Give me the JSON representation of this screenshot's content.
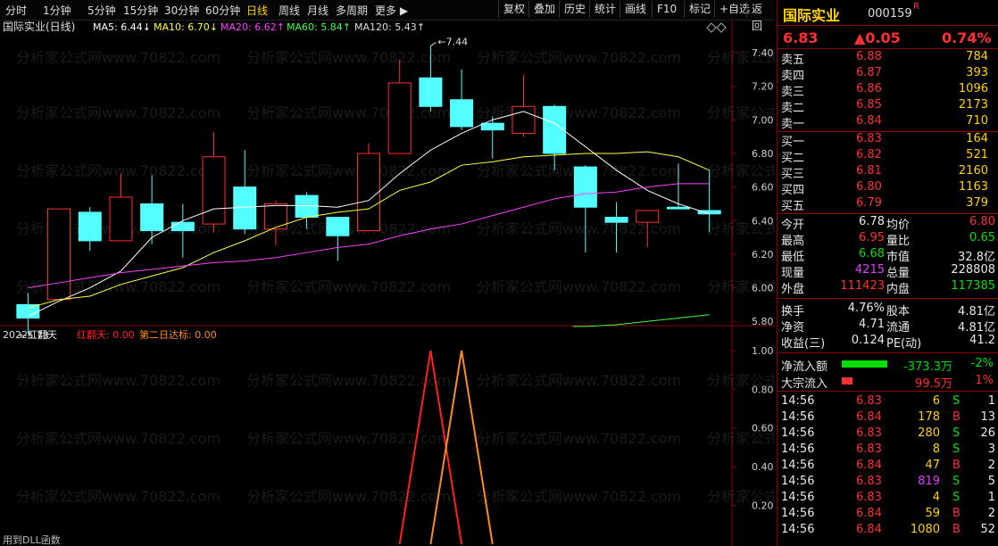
{
  "toolbar": {
    "periods": [
      "分时",
      "1分钟",
      "5分钟",
      "15分钟",
      "30分钟",
      "60分钟",
      "日线",
      "周线",
      "月线",
      "多周期",
      "更多"
    ],
    "active_period": "日线",
    "buttons": [
      "复权",
      "叠加",
      "历史",
      "统计",
      "画线",
      "F10",
      "标记",
      "+自选",
      "返回"
    ]
  },
  "chart_title": "国际实业(日线)",
  "ma_legend": [
    {
      "label": "MA5: 6.44↓",
      "color": "#ffffff"
    },
    {
      "label": "MA10: 6.70↓",
      "color": "#ffff40"
    },
    {
      "label": "MA20: 6.62↑",
      "color": "#ff40ff"
    },
    {
      "label": "MA60: 5.84↑",
      "color": "#40ff40"
    },
    {
      "label": "MA120: 5.43↑",
      "color": "#dddddd"
    }
  ],
  "annotations": {
    "high": "7.44",
    "low": "5.73"
  },
  "indicator": {
    "name": "2022红翻天",
    "s1": "红翻天: 0.00",
    "s2": "第二日达标: 0.00",
    "footer": "用到DLL函数"
  },
  "watermark": "分析家公式网www.70822.com",
  "chart_data": [
    {
      "type": "candlestick",
      "title": "国际实业(日线)",
      "ylim": [
        5.78,
        7.48
      ],
      "yticks": [
        5.8,
        6.0,
        6.2,
        6.4,
        6.6,
        6.8,
        7.0,
        7.2,
        7.4
      ],
      "candles": [
        {
          "o": 5.9,
          "c": 5.82,
          "h": 5.97,
          "l": 5.73
        },
        {
          "o": 5.93,
          "c": 6.47,
          "h": 6.47,
          "l": 5.93
        },
        {
          "o": 6.45,
          "c": 6.28,
          "h": 6.48,
          "l": 6.22
        },
        {
          "o": 6.28,
          "c": 6.54,
          "h": 6.68,
          "l": 6.28
        },
        {
          "o": 6.5,
          "c": 6.34,
          "h": 6.67,
          "l": 6.26
        },
        {
          "o": 6.39,
          "c": 6.34,
          "h": 6.5,
          "l": 6.18
        },
        {
          "o": 6.38,
          "c": 6.78,
          "h": 6.93,
          "l": 6.33
        },
        {
          "o": 6.6,
          "c": 6.35,
          "h": 6.82,
          "l": 6.32
        },
        {
          "o": 6.35,
          "c": 6.5,
          "h": 6.52,
          "l": 6.25
        },
        {
          "o": 6.55,
          "c": 6.42,
          "h": 6.57,
          "l": 6.35
        },
        {
          "o": 6.42,
          "c": 6.31,
          "h": 6.42,
          "l": 6.16
        },
        {
          "o": 6.34,
          "c": 6.8,
          "h": 6.86,
          "l": 6.34
        },
        {
          "o": 6.8,
          "c": 7.22,
          "h": 7.36,
          "l": 6.8
        },
        {
          "o": 7.25,
          "c": 7.08,
          "h": 7.44,
          "l": 7.05
        },
        {
          "o": 7.12,
          "c": 6.96,
          "h": 7.3,
          "l": 6.94
        },
        {
          "o": 6.98,
          "c": 6.94,
          "h": 7.02,
          "l": 6.77
        },
        {
          "o": 6.92,
          "c": 7.08,
          "h": 7.27,
          "l": 6.9
        },
        {
          "o": 7.08,
          "c": 6.8,
          "h": 7.09,
          "l": 6.7
        },
        {
          "o": 6.72,
          "c": 6.48,
          "h": 6.73,
          "l": 6.21
        },
        {
          "o": 6.42,
          "c": 6.39,
          "h": 6.51,
          "l": 6.21
        },
        {
          "o": 6.39,
          "c": 6.46,
          "h": 6.46,
          "l": 6.24
        },
        {
          "o": 6.48,
          "c": 6.47,
          "h": 6.74,
          "l": 6.47
        },
        {
          "o": 6.46,
          "c": 6.44,
          "h": 6.7,
          "l": 6.33
        }
      ],
      "ma": [
        {
          "name": "MA5",
          "color": "#ffffff",
          "values": [
            5.83,
            5.92,
            6.0,
            6.1,
            6.3,
            6.4,
            6.47,
            6.48,
            6.49,
            6.49,
            6.48,
            6.52,
            6.68,
            6.82,
            6.92,
            7.0,
            7.05,
            6.98,
            6.84,
            6.7,
            6.58,
            6.5,
            6.44
          ]
        },
        {
          "name": "MA10",
          "color": "#ffff40",
          "values": [
            5.88,
            5.93,
            5.95,
            6.02,
            6.07,
            6.12,
            6.21,
            6.28,
            6.36,
            6.42,
            6.45,
            6.47,
            6.58,
            6.63,
            6.73,
            6.75,
            6.78,
            6.79,
            6.8,
            6.8,
            6.81,
            6.78,
            6.7
          ]
        },
        {
          "name": "MA20",
          "color": "#ff40ff",
          "values": [
            6.0,
            6.03,
            6.06,
            6.09,
            6.11,
            6.13,
            6.15,
            6.16,
            6.18,
            6.21,
            6.24,
            6.26,
            6.31,
            6.35,
            6.38,
            6.43,
            6.48,
            6.53,
            6.56,
            6.57,
            6.6,
            6.62,
            6.62
          ]
        },
        {
          "name": "MA60",
          "color": "#40ff40",
          "values": [
            null,
            null,
            null,
            null,
            null,
            null,
            null,
            null,
            null,
            null,
            null,
            null,
            null,
            null,
            null,
            null,
            null,
            null,
            5.77,
            5.78,
            5.8,
            5.82,
            5.84
          ]
        }
      ]
    },
    {
      "type": "line",
      "title": "2022红翻天",
      "ylim": [
        0,
        1.05
      ],
      "yticks": [
        0.2,
        0.4,
        0.6,
        0.8,
        1.0
      ],
      "series": [
        {
          "name": "红翻天",
          "color": "#ff2020",
          "values": [
            0,
            0,
            0,
            0,
            0,
            0,
            0,
            0,
            0,
            0,
            0,
            0,
            0,
            1,
            0,
            0,
            0,
            0,
            0,
            0,
            0,
            0,
            0
          ]
        },
        {
          "name": "第二日达标",
          "color": "#ff8c20",
          "values": [
            0,
            0,
            0,
            0,
            0,
            0,
            0,
            0,
            0,
            0,
            0,
            0,
            0,
            0,
            1,
            0,
            0,
            0,
            0,
            0,
            0,
            0,
            0
          ]
        }
      ]
    }
  ],
  "quote": {
    "name": "国际实业",
    "code": "000159",
    "flag": "R",
    "price": "6.83",
    "change": "▲0.05",
    "pct": "0.74%",
    "asks": [
      {
        "label": "卖五",
        "price": "6.88",
        "vol": "784"
      },
      {
        "label": "卖四",
        "price": "6.87",
        "vol": "393"
      },
      {
        "label": "卖三",
        "price": "6.86",
        "vol": "1096"
      },
      {
        "label": "卖二",
        "price": "6.85",
        "vol": "2173"
      },
      {
        "label": "卖一",
        "price": "6.84",
        "vol": "710"
      }
    ],
    "bids": [
      {
        "label": "买一",
        "price": "6.83",
        "vol": "164"
      },
      {
        "label": "买二",
        "price": "6.82",
        "vol": "521"
      },
      {
        "label": "买三",
        "price": "6.81",
        "vol": "2160"
      },
      {
        "label": "买四",
        "price": "6.80",
        "vol": "1163"
      },
      {
        "label": "买五",
        "price": "6.79",
        "vol": "379"
      }
    ],
    "stats": [
      {
        "l1": "今开",
        "v1": "6.78",
        "c1": "white",
        "l2": "均价",
        "v2": "6.80",
        "c2": "red"
      },
      {
        "l1": "最高",
        "v1": "6.95",
        "c1": "red",
        "l2": "量比",
        "v2": "0.65",
        "c2": "green"
      },
      {
        "l1": "最低",
        "v1": "6.68",
        "c1": "green",
        "l2": "市值",
        "v2": "32.8亿",
        "c2": "white"
      },
      {
        "l1": "现量",
        "v1": "4215",
        "c1": "mag",
        "l2": "总量",
        "v2": "228808",
        "c2": "white"
      },
      {
        "l1": "外盘",
        "v1": "111423",
        "c1": "red",
        "l2": "内盘",
        "v2": "117385",
        "c2": "green"
      }
    ],
    "stats2": [
      {
        "l1": "换手",
        "v1": "4.76%",
        "c1": "white",
        "l2": "股本",
        "v2": "4.81亿",
        "c2": "white"
      },
      {
        "l1": "净资",
        "v1": "4.71",
        "c1": "white",
        "l2": "流通",
        "v2": "4.81亿",
        "c2": "white"
      },
      {
        "l1": "收益(三)",
        "v1": "0.124",
        "c1": "white",
        "l2": "PE(动)",
        "v2": "41.2",
        "c2": "white"
      }
    ],
    "flows": [
      {
        "label": "净流入额",
        "value": "-373.3万",
        "pct": "-2%",
        "color": "#00e000",
        "bar": 0.85
      },
      {
        "label": "大宗流入",
        "value": "99.5万",
        "pct": "1%",
        "color": "#ff3030",
        "bar": 0.2
      }
    ],
    "ticks": [
      {
        "t": "14:56",
        "p": "6.83",
        "v": "6",
        "s": "S",
        "n": "1"
      },
      {
        "t": "14:56",
        "p": "6.84",
        "v": "178",
        "s": "B",
        "n": "13"
      },
      {
        "t": "14:56",
        "p": "6.83",
        "v": "280",
        "s": "S",
        "n": "26"
      },
      {
        "t": "14:56",
        "p": "6.83",
        "v": "8",
        "s": "S",
        "n": "3"
      },
      {
        "t": "14:56",
        "p": "6.84",
        "v": "47",
        "s": "B",
        "n": "2"
      },
      {
        "t": "14:56",
        "p": "6.83",
        "v": "819",
        "s": "S",
        "n": "5"
      },
      {
        "t": "14:56",
        "p": "6.83",
        "v": "4",
        "s": "S",
        "n": "1"
      },
      {
        "t": "14:56",
        "p": "6.84",
        "v": "59",
        "s": "B",
        "n": "2"
      },
      {
        "t": "14:56",
        "p": "6.84",
        "v": "1080",
        "s": "B",
        "n": "52"
      }
    ]
  }
}
